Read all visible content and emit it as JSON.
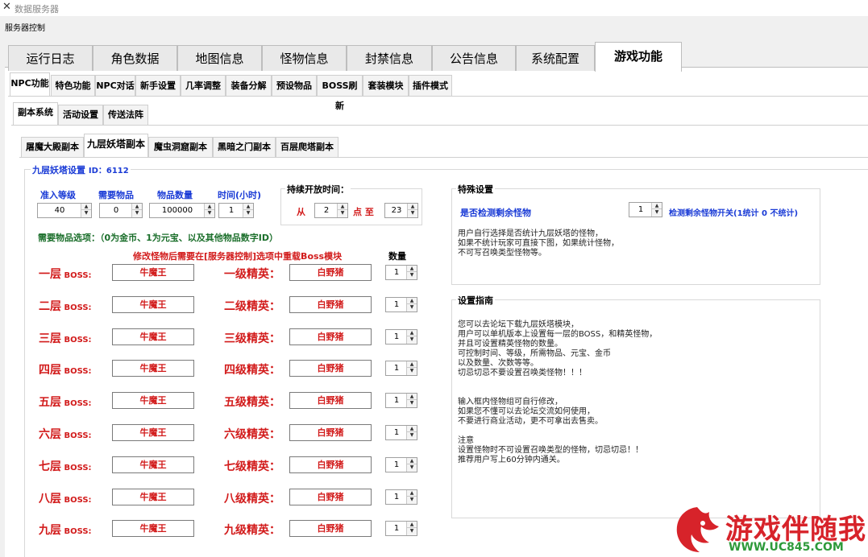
{
  "window": {
    "title": "数据服务器",
    "menu": "服务器控制"
  },
  "main_tabs": [
    "运行日志",
    "角色数据",
    "地图信息",
    "怪物信息",
    "封禁信息",
    "公告信息",
    "系统配置",
    "游戏功能"
  ],
  "sub_tabs": [
    "NPC功能",
    "特色功能",
    "NPC对话",
    "新手设置",
    "几率调整",
    "装备分解",
    "预设物品",
    "BOSS刷新",
    "套装模块",
    "插件模式"
  ],
  "sub2_tabs": [
    "副本系统",
    "活动设置",
    "传送法阵"
  ],
  "dungeon_tabs": [
    "屠魔大殿副本",
    "九层妖塔副本",
    "魔虫洞窟副本",
    "黑暗之门副本",
    "百层爬塔副本"
  ],
  "tower": {
    "group_title": "九层妖塔设置",
    "id_label": "ID：6112",
    "labels": {
      "level": "准入等级",
      "item": "需要物品",
      "qty": "物品数量",
      "time": "时间(小时)"
    },
    "values": {
      "level": "40",
      "item": "0",
      "qty": "100000",
      "time": "1"
    },
    "open_time": {
      "title": "持续开放时间：",
      "from": "从",
      "start": "2",
      "point_to": "点 至",
      "end": "23"
    },
    "item_hint": "需要物品选项：（0为金币、1为元宝、以及其他物品数字ID）",
    "modify_hint": "修改怪物后需要在[服务器控制]选项中重载Boss模块",
    "count_label": "数量",
    "floors": [
      {
        "floor": "一层",
        "boss_label": "BOSS:",
        "boss": "牛魔王",
        "elite_label": "一级精英：",
        "elite": "白野猪",
        "count": "1"
      },
      {
        "floor": "二层",
        "boss_label": "BOSS:",
        "boss": "牛魔王",
        "elite_label": "二级精英：",
        "elite": "白野猪",
        "count": "1"
      },
      {
        "floor": "三层",
        "boss_label": "BOSS:",
        "boss": "牛魔王",
        "elite_label": "三级精英：",
        "elite": "白野猪",
        "count": "1"
      },
      {
        "floor": "四层",
        "boss_label": "BOSS:",
        "boss": "牛魔王",
        "elite_label": "四级精英：",
        "elite": "白野猪",
        "count": "1"
      },
      {
        "floor": "五层",
        "boss_label": "BOSS:",
        "boss": "牛魔王",
        "elite_label": "五级精英：",
        "elite": "白野猪",
        "count": "1"
      },
      {
        "floor": "六层",
        "boss_label": "BOSS:",
        "boss": "牛魔王",
        "elite_label": "六级精英：",
        "elite": "白野猪",
        "count": "1"
      },
      {
        "floor": "七层",
        "boss_label": "BOSS:",
        "boss": "牛魔王",
        "elite_label": "七级精英：",
        "elite": "白野猪",
        "count": "1"
      },
      {
        "floor": "八层",
        "boss_label": "BOSS:",
        "boss": "牛魔王",
        "elite_label": "八级精英：",
        "elite": "白野猪",
        "count": "1"
      },
      {
        "floor": "九层",
        "boss_label": "BOSS:",
        "boss": "牛魔王",
        "elite_label": "九级精英：",
        "elite": "白野猪",
        "count": "1"
      }
    ]
  },
  "special": {
    "title": "特殊设置",
    "check_label": "是否检测剩余怪物",
    "check_value": "1",
    "switch_label": "检测剩余怪物开关(1统计 0 不统计)",
    "desc": "用户自行选择是否统计九层妖塔的怪物，\n如果不统计玩家可直接下图，如果统计怪物，\n不可写召唤类型怪物等。"
  },
  "guide": {
    "title": "设置指南",
    "text": "您可以去论坛下载九层妖塔模块，\n用户可以单机版本上设置每一层的BOSS，和精英怪物，\n并且可设置精英怪物的数量。\n可控制时间、等级，所需物品、元宝、金币\n以及数量、次数等等。\n切忌切忌不要设置召唤类怪物！！！\n\n\n输入框内怪物组可自行修改，\n如果您不懂可以去论坛交流如何使用，\n不要进行商业活动，更不可拿出去售卖。\n\n注意\n设置怪物时不可设置召唤类型的怪物，切忌切忌！！\n推荐用户写上60分钟内通关。"
  },
  "watermark": {
    "name": "游戏伴随我",
    "url": "WWW.UC845.COM"
  },
  "colors": {
    "blue": "#1a3bd6",
    "red": "#d21b1b",
    "watermark_red": "#d7232a",
    "watermark_green": "#2e9a3a"
  }
}
